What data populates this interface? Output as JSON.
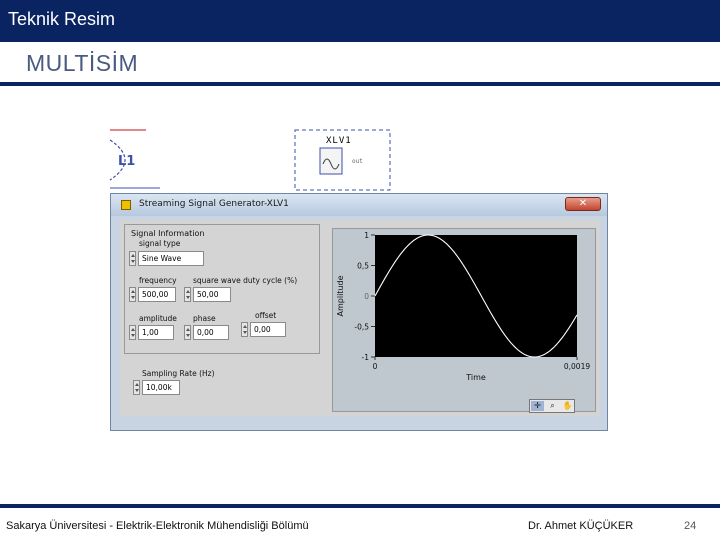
{
  "header": {
    "title": "Teknik Resim"
  },
  "slide": {
    "subtitle": "MULTİSİM"
  },
  "schematic": {
    "inductor_label": "L1",
    "instrument_label": "XLV1",
    "instrument_port": "out"
  },
  "window": {
    "title": "Streaming Signal Generator-XLV1",
    "close_icon": "close-icon",
    "group_label": "Signal Information",
    "signal_type": {
      "label": "signal type",
      "value": "Sine Wave"
    },
    "frequency": {
      "label": "frequency",
      "value": "500,00"
    },
    "duty_cycle": {
      "label": "square wave duty cycle (%)",
      "value": "50,00"
    },
    "amplitude": {
      "label": "amplitude",
      "value": "1,00"
    },
    "phase": {
      "label": "phase",
      "value": "0,00"
    },
    "offset": {
      "label": "offset",
      "value": "0,00"
    },
    "sampling_rate": {
      "label": "Sampling Rate (Hz)",
      "value": "10,00k"
    },
    "toolbar": [
      "cursor-icon",
      "zoom-icon",
      "pan-icon"
    ]
  },
  "chart_data": {
    "type": "line",
    "xlabel": "Time",
    "ylabel": "Amplitude",
    "xlim": [
      0,
      0.0019
    ],
    "ylim": [
      -1,
      1
    ],
    "x_ticks": [
      "0",
      "0,0019"
    ],
    "y_ticks": [
      "1",
      "0,5",
      "0",
      "-0,5",
      "-1"
    ],
    "series": [
      {
        "function": "sine",
        "amplitude": 1,
        "frequency_hz": 500,
        "phase": 0,
        "offset": 0
      }
    ],
    "line_color": "#ffffff",
    "background": "#000000"
  },
  "footer": {
    "university": "Sakarya Üniversitesi - Elektrik-Elektronik Mühendisliği Bölümü",
    "author": "Dr. Ahmet KÜÇÜKER",
    "page": "24"
  }
}
